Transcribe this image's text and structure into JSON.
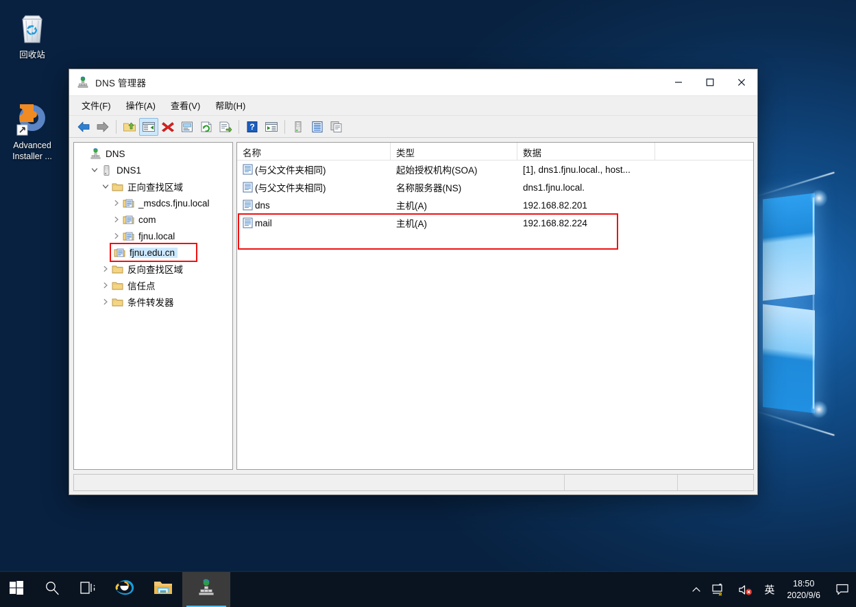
{
  "desktop": {
    "icons": [
      {
        "name": "recycle-bin",
        "label": "回收站"
      },
      {
        "name": "advanced-installer",
        "label": "Advanced Installer ..."
      }
    ]
  },
  "window": {
    "title": "DNS 管理器",
    "title_icon": "dns-server-icon",
    "controls": {
      "minimize": "minimize-icon",
      "maximize": "maximize-icon",
      "close": "close-icon"
    },
    "menus": [
      {
        "name": "file",
        "label": "文件(F)"
      },
      {
        "name": "action",
        "label": "操作(A)"
      },
      {
        "name": "view",
        "label": "查看(V)"
      },
      {
        "name": "help",
        "label": "帮助(H)"
      }
    ],
    "toolbar": [
      {
        "name": "back-button",
        "icon": "arrow-left-icon",
        "checked": false
      },
      {
        "name": "forward-button",
        "icon": "arrow-right-icon",
        "checked": false
      },
      {
        "name": "separator-1",
        "icon": "separator",
        "checked": false
      },
      {
        "name": "up-one-level-button",
        "icon": "folder-up-icon",
        "checked": false
      },
      {
        "name": "show-hide-console-tree-button",
        "icon": "console-tree-icon",
        "checked": true
      },
      {
        "name": "delete-button",
        "icon": "red-x-icon",
        "checked": false
      },
      {
        "name": "properties-button",
        "icon": "properties-icon",
        "checked": false
      },
      {
        "name": "refresh-button",
        "icon": "refresh-icon",
        "checked": false
      },
      {
        "name": "export-list-button",
        "icon": "export-list-icon",
        "checked": false
      },
      {
        "name": "separator-2",
        "icon": "separator",
        "checked": false
      },
      {
        "name": "help-button",
        "icon": "help-question-icon",
        "checked": false
      },
      {
        "name": "run-button",
        "icon": "run-window-icon",
        "checked": false
      },
      {
        "name": "separator-3",
        "icon": "separator",
        "checked": false
      },
      {
        "name": "new-server-button",
        "icon": "server-icon",
        "checked": false
      },
      {
        "name": "new-zone-button",
        "icon": "zone-list-icon",
        "checked": false
      },
      {
        "name": "copy-button",
        "icon": "copy-icon",
        "checked": false
      }
    ],
    "tree": [
      {
        "name": "dns-root",
        "label": "DNS",
        "indent": 0,
        "twist": "none",
        "icon": "dns-root-icon",
        "selected": false,
        "highlight": false
      },
      {
        "name": "dns1-server",
        "label": "DNS1",
        "indent": 1,
        "twist": "open",
        "icon": "server-icon",
        "selected": false,
        "highlight": false
      },
      {
        "name": "forward-lookup-zones",
        "label": "正向查找区域",
        "indent": 2,
        "twist": "open",
        "icon": "folder-icon",
        "selected": false,
        "highlight": false
      },
      {
        "name": "zone-msdcs-fjnu-local",
        "label": "_msdcs.fjnu.local",
        "indent": 3,
        "twist": "closed",
        "icon": "zone-icon",
        "selected": false,
        "highlight": false
      },
      {
        "name": "zone-com",
        "label": "com",
        "indent": 3,
        "twist": "closed",
        "icon": "zone-icon",
        "selected": false,
        "highlight": false
      },
      {
        "name": "zone-fjnu-local",
        "label": "fjnu.local",
        "indent": 3,
        "twist": "closed",
        "icon": "zone-icon",
        "selected": false,
        "highlight": false
      },
      {
        "name": "zone-fjnu-edu-cn",
        "label": "fjnu.edu.cn",
        "indent": 3,
        "twist": "none",
        "icon": "zone-icon",
        "selected": true,
        "highlight": true
      },
      {
        "name": "reverse-lookup-zones",
        "label": "反向查找区域",
        "indent": 2,
        "twist": "closed",
        "icon": "folder-icon",
        "selected": false,
        "highlight": false
      },
      {
        "name": "trust-points",
        "label": "信任点",
        "indent": 2,
        "twist": "closed",
        "icon": "folder-icon",
        "selected": false,
        "highlight": false
      },
      {
        "name": "conditional-forwarders",
        "label": "条件转发器",
        "indent": 2,
        "twist": "closed",
        "icon": "folder-icon",
        "selected": false,
        "highlight": false
      }
    ],
    "list": {
      "columns": [
        {
          "name": "column-name",
          "label": "名称"
        },
        {
          "name": "column-type",
          "label": "类型"
        },
        {
          "name": "column-data",
          "label": "数据"
        }
      ],
      "rows": [
        {
          "name": "(与父文件夹相同)",
          "type": "起始授权机构(SOA)",
          "data": "[1], dns1.fjnu.local., host...",
          "highlight": false
        },
        {
          "name": "(与父文件夹相同)",
          "type": "名称服务器(NS)",
          "data": "dns1.fjnu.local.",
          "highlight": false
        },
        {
          "name": "dns",
          "type": "主机(A)",
          "data": "192.168.82.201",
          "highlight": true
        },
        {
          "name": "mail",
          "type": "主机(A)",
          "data": "192.168.82.224",
          "highlight": true
        }
      ]
    },
    "statusbar": {
      "pane1": "",
      "pane2": "",
      "pane3": ""
    }
  },
  "taskbar": {
    "items": [
      {
        "name": "start-button",
        "icon": "windows-logo-icon"
      },
      {
        "name": "search-button",
        "icon": "search-icon"
      },
      {
        "name": "task-view-button",
        "icon": "task-view-icon"
      },
      {
        "name": "internet-explorer-button",
        "icon": "internet-explorer-icon"
      },
      {
        "name": "file-explorer-button",
        "icon": "folder-icon"
      },
      {
        "name": "dns-manager-taskbar-button",
        "icon": "dns-server-icon"
      }
    ],
    "tray": {
      "show_hidden": "chevron-up-icon",
      "network": "network-warning-icon",
      "volume": "volume-muted-icon",
      "ime": "英",
      "time": "18:50",
      "date": "2020/9/6",
      "action_center": "action-center-icon"
    }
  },
  "colors": {
    "accent_blue": "#0078d7",
    "highlight_red": "#ee1111",
    "selection_blue": "#cce8ff",
    "taskbar_bg": "#0a1421"
  }
}
